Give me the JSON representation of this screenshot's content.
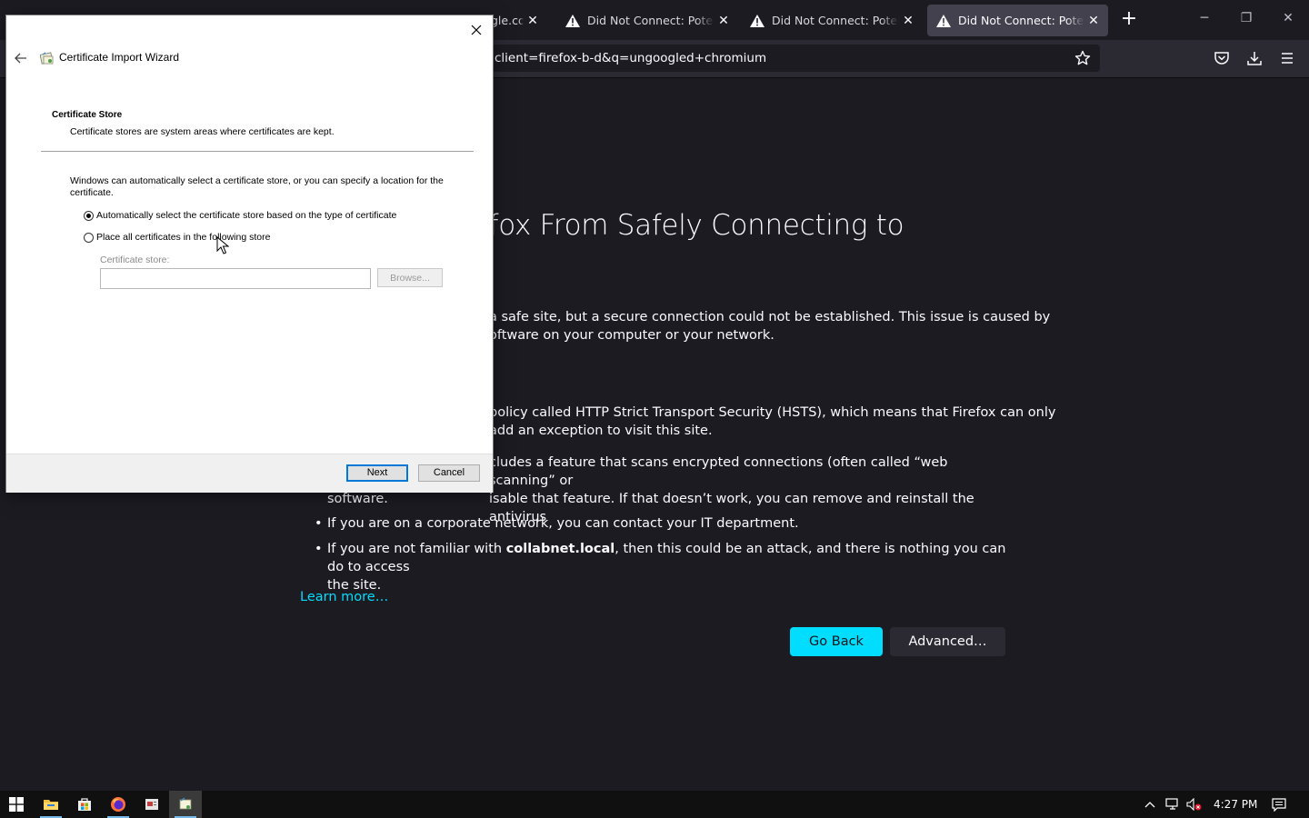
{
  "browser": {
    "tabs": [
      {
        "title": "gle.com",
        "active": false
      },
      {
        "title": "Did Not Connect: Potential",
        "active": false
      },
      {
        "title": "Did Not Connect: Potential",
        "active": false
      },
      {
        "title": "Did Not Connect: Potential",
        "active": true
      }
    ],
    "new_tab_label": "+",
    "url": "client=firefox-b-d&q=ungoogled+chromium"
  },
  "error_page": {
    "title": "venting Firefox From Safely Connecting to",
    "paragraph1_line1": "a safe site, but a secure connection could not be established. This issue is caused by",
    "paragraph1_line2": "oftware on your computer or your network.",
    "hsts_line1": "policy called HTTP Strict Transport Security (HSTS), which means that Firefox can only",
    "hsts_line2": "add an exception to visit this site.",
    "av_line1": "cludes a feature that scans encrypted connections (often called “web scanning” or",
    "av_line2": "isable that feature. If that doesn’t work, you can remove and reinstall the antivirus",
    "av_line3": "software.",
    "bullet_corporate": "If you are on a corporate network, you can contact your IT department.",
    "bullet_attack_prefix": "If you are not familiar with ",
    "bullet_attack_host": "collabnet.local",
    "bullet_attack_suffix": ", then this could be an attack, and there is nothing you can do to access",
    "bullet_attack_line2": "the site.",
    "learn_more": "Learn more…",
    "go_back": "Go Back",
    "advanced": "Advanced…"
  },
  "wizard": {
    "title": "Certificate Import Wizard",
    "section_title": "Certificate Store",
    "section_desc": "Certificate stores are system areas where certificates are kept.",
    "intro": "Windows can automatically select a certificate store, or you can specify a location for the certificate.",
    "option_auto": "Automatically select the certificate store based on the type of certificate",
    "option_auto_selected": true,
    "option_place": "Place all certificates in the following store",
    "store_label": "Certificate store:",
    "store_value": "",
    "browse": "Browse...",
    "next": "Next",
    "cancel": "Cancel"
  },
  "taskbar": {
    "clock": "4:27 PM"
  }
}
